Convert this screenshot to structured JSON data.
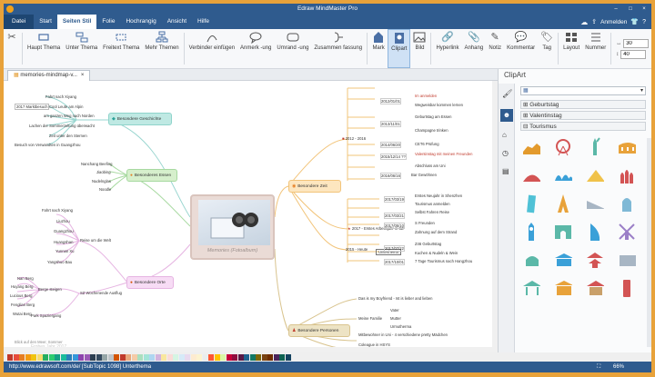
{
  "app": {
    "title": "Edraw MindMaster Pro",
    "account": "Anmelden",
    "menus": [
      "Datei",
      "Start",
      "Seiten Stil",
      "Folie",
      "Hochrangig",
      "Ansicht",
      "Hilfe"
    ],
    "active_menu": "Seiten Stil"
  },
  "ribbon": {
    "items": [
      {
        "label": "Haupt Thema",
        "icon": "main-topic-icon"
      },
      {
        "label": "Unter Thema",
        "icon": "subtopic-icon"
      },
      {
        "label": "Freitext Thema",
        "icon": "floating-topic-icon"
      },
      {
        "label": "Mehr Themen",
        "icon": "more-topics-icon"
      },
      {
        "label": "Verbinder einfügen",
        "icon": "connector-icon"
      },
      {
        "label": "Anmerk -ung",
        "icon": "callout-icon"
      },
      {
        "label": "Umrand -ung",
        "icon": "boundary-icon"
      },
      {
        "label": "Zusammen fassung",
        "icon": "summary-icon"
      },
      {
        "label": "Mark",
        "icon": "mark-icon"
      },
      {
        "label": "Clipart",
        "icon": "clipart-icon"
      },
      {
        "label": "Bild",
        "icon": "image-icon"
      },
      {
        "label": "Hyperlink",
        "icon": "hyperlink-icon"
      },
      {
        "label": "Anhang",
        "icon": "attachment-icon"
      },
      {
        "label": "Notiz",
        "icon": "note-icon"
      },
      {
        "label": "Kommentar",
        "icon": "comment-icon"
      },
      {
        "label": "Tag",
        "icon": "tag-icon"
      },
      {
        "label": "Layout",
        "icon": "layout-icon"
      },
      {
        "label": "Nummer",
        "icon": "numbering-icon"
      }
    ],
    "spin1": "30",
    "spin2": "40",
    "selected": "Clipart"
  },
  "document_tab": "memories-mindmap-v...",
  "sidebar": {
    "title": "ClipArt",
    "categories": [
      "Geburtstag",
      "Valentinstag",
      "Tourismus"
    ]
  },
  "mindmap": {
    "central": "Memories (Fotoalbum)",
    "topics": {
      "history": "Besondere Geschichte",
      "food": "Besonderes Essen",
      "places": "Besondere Orte",
      "time": "Besondere Zeit",
      "people": "Besondere Personen"
    },
    "history_items": [
      "Fahrt nach Xiyang",
      "Cool Leute am Alpin",
      "am ganzen Weg nach Norden",
      "Lachen der Sommerzeltung überwacht",
      "Zeit unter den Sternen",
      "Besuch von Verwandten in Guangzhou"
    ],
    "history_tag": "2017 Marktbesuch",
    "food_items": [
      "Nanchang Beefing",
      "Jiaobing",
      "Nudelnglas",
      "Noodle"
    ],
    "places_items": [
      "Reise um die Welt",
      "SZ Wochenende Ausflug",
      "Berge steigen",
      "Park Spaziergang",
      "Blick auf den Meer, Sommer"
    ],
    "places_cities": [
      "Fahrt nach Xiyang",
      "Liuzhou",
      "Guangzhou",
      "Huangshan",
      "Yunnan Xu",
      "Yangshuo Bau"
    ],
    "places_mountains": [
      "Nan Berg",
      "Huyang Berg",
      "Lucious Berg",
      "Fenglian Berg",
      "Wutai Berg"
    ],
    "time_groups": [
      "2012 - 2016",
      "2017 - Erstes Arbeitsjahr in SZ",
      "2015 - Heute"
    ],
    "time_2012": [
      {
        "date": "2012/01/01",
        "label": "Im anmelden"
      },
      {
        "date": "",
        "label": "Wegweisbar kommen lernen"
      },
      {
        "date": "2013/11/01",
        "label": "Geburtstag am Essen"
      },
      {
        "date": "",
        "label": "Champagne trinken"
      },
      {
        "date": "2014/06/20",
        "label": "CET6 Prüfung"
      },
      {
        "date": "2015/12/14 ??",
        "label": "Valentinstag mit meinen Freunden"
      },
      {
        "date": "",
        "label": "Abschluss am Uni"
      },
      {
        "date": "2016/06/16",
        "label": "Bar Gewöhnen"
      }
    ],
    "time_2017": [
      {
        "date": "2017/03/19",
        "label": "Erstes Neujahr in Shenzhen"
      },
      {
        "date": "",
        "label": "Tourismus anmelden"
      },
      {
        "date": "2017/03/21",
        "label": "Selbst Fahren Reise"
      },
      {
        "date": "2017/05/10",
        "label": "S Freunden"
      },
      {
        "date": "",
        "label": "Zahnung auf dem Strand"
      },
      {
        "date": "2017/07/22",
        "label": "Z46 Geburtstag"
      },
      {
        "date": "",
        "label": "Kuchen & Nudeln & Wein"
      },
      {
        "date": "2017/10/01",
        "label": "7 Tage Tourismus nach Hangzhou"
      }
    ],
    "time_heute": "Unterthema",
    "people_items": [
      "Das is my Boyfriend - Ist is lieber and lieben",
      "Meine Familie",
      "Mitbewohner in Uni - 4 verschiedene pretty Mädchen",
      "Coleague in HSYS"
    ],
    "people_family": [
      "Vater",
      "Mutter",
      "Urmutherma"
    ],
    "faded_text": "Frohes Jahr 2017"
  },
  "status": {
    "text": "http://www.edrawsoft.com/de/  [SubTopic 1098]  Unterthema",
    "zoom": "66%"
  },
  "palette": [
    "#c0392b",
    "#e74c3c",
    "#e67e22",
    "#f39c12",
    "#f1c40f",
    "#f7dc6f",
    "#27ae60",
    "#2ecc71",
    "#16a085",
    "#1abc9c",
    "#2980b9",
    "#3498db",
    "#8e44ad",
    "#9b59b6",
    "#2c3e50",
    "#34495e",
    "#95a5a6",
    "#bdc3c7",
    "#d35400",
    "#c0392b",
    "#e8a87c",
    "#f5cba7",
    "#a9dfbf",
    "#a3e4d7",
    "#aed6f1",
    "#d2b4de",
    "#f9e79f",
    "#fadbd8",
    "#d5f5e3",
    "#d6eaf8",
    "#e8daef",
    "#fdebd0",
    "#fcf3cf",
    "#eaeded",
    "#ff5733",
    "#ffc300",
    "#daf7a6",
    "#c70039",
    "#900c3f",
    "#581845",
    "#1f618d",
    "#117864",
    "#7d6608",
    "#784212",
    "#6e2c00",
    "#4a235a",
    "#0e6251",
    "#154360"
  ]
}
